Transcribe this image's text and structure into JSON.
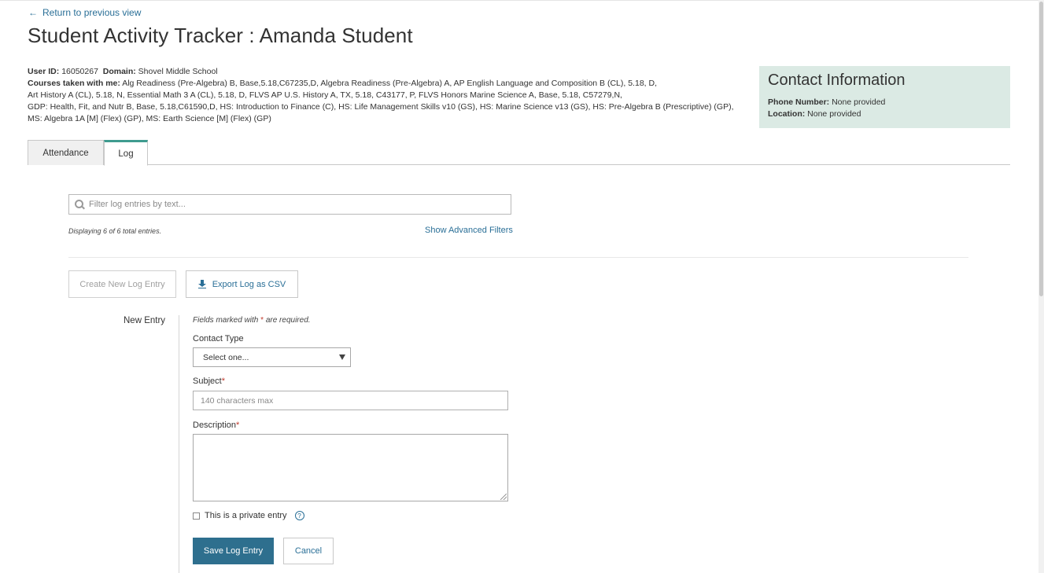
{
  "nav": {
    "back_label": "Return to previous view"
  },
  "page": {
    "title": "Student Activity Tracker : Amanda Student"
  },
  "student": {
    "user_id_label": "User ID:",
    "user_id": "16050267",
    "domain_label": "Domain:",
    "domain": "Shovel Middle School",
    "courses_label": "Courses taken with me:",
    "courses_lines": [
      "Alg Readiness (Pre-Algebra) B, Base,5.18,C67235,D,  Algebra Readiness (Pre-Algebra) A,  AP English Language and Composition B (CL), 5.18, D,",
      "Art History A (CL), 5.18, N,  Essential Math 3 A (CL), 5.18, D,  FLVS AP U.S. History A, TX, 5.18, C43177, P,  FLVS Honors Marine Science A, Base, 5.18, C57279,N,",
      "GDP: Health, Fit, and Nutr B, Base, 5.18,C61590,D,  HS: Introduction to Finance (C),  HS: Life Management Skills v10 (GS),  HS: Marine Science v13 (GS),  HS: Pre-Algebra B (Prescriptive) (GP),",
      "MS: Algebra 1A [M] (Flex) (GP),  MS: Earth Science [M] (Flex) (GP)"
    ]
  },
  "contact": {
    "title": "Contact Information",
    "phone_label": "Phone Number:",
    "phone": "None provided",
    "location_label": "Location:",
    "location": "None provided"
  },
  "tabs": [
    {
      "label": "Attendance",
      "active": false
    },
    {
      "label": "Log",
      "active": true
    }
  ],
  "filter": {
    "placeholder": "Filter log entries by text...",
    "count_text": "Displaying 6 of 6 total entries.",
    "advanced_label": "Show Advanced Filters"
  },
  "actions": {
    "create_label": "Create New Log Entry",
    "export_label": "Export Log as CSV"
  },
  "form": {
    "section_label": "New Entry",
    "required_note_prefix": "Fields marked with",
    "required_star": "*",
    "required_note_suffix": "are required.",
    "contact_type_label": "Contact Type",
    "contact_type_value": "Select one...",
    "subject_label": "Subject",
    "subject_placeholder": "140 characters max",
    "description_label": "Description",
    "private_label": "This is a private entry",
    "help_glyph": "?",
    "save_label": "Save Log Entry",
    "cancel_label": "Cancel"
  },
  "colors": {
    "accent": "#2a6f97",
    "primary_button": "#2e6f8e",
    "tab_active_border": "#3f9b8f",
    "contact_bg": "#dbeae4",
    "required": "#c0392b"
  }
}
